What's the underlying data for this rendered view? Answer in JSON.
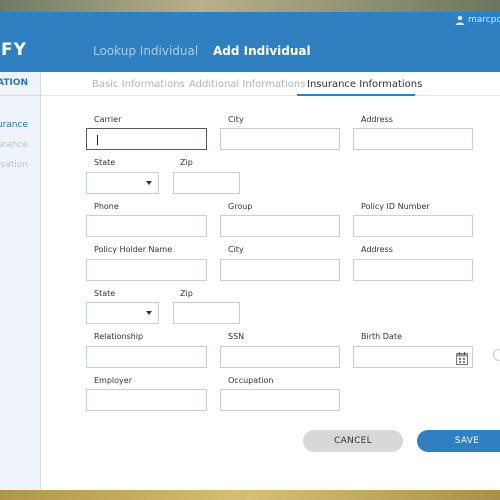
{
  "app": {
    "logo": "FY"
  },
  "header": {
    "nav": [
      {
        "label": "Lookup Individual"
      },
      {
        "label": "Add Individual"
      }
    ],
    "user": {
      "name": "marcpota"
    }
  },
  "sidebar": {
    "title": "MATION",
    "items": [
      {
        "label": "urance"
      },
      {
        "label": "urance"
      },
      {
        "label": "nsation"
      }
    ]
  },
  "tabs": [
    {
      "label": "Basic Informations"
    },
    {
      "label": "Additional Informations"
    },
    {
      "label": "Insurance Informations"
    }
  ],
  "form": {
    "carrier": {
      "label": "Carrier",
      "value": ""
    },
    "city1": {
      "label": "City",
      "value": ""
    },
    "address1": {
      "label": "Address",
      "value": ""
    },
    "state1": {
      "label": "State",
      "value": ""
    },
    "zip1": {
      "label": "Zip",
      "value": ""
    },
    "phone": {
      "label": "Phone",
      "value": ""
    },
    "group": {
      "label": "Group",
      "value": ""
    },
    "policy_id": {
      "label": "Policy ID Number",
      "value": ""
    },
    "holder_name": {
      "label": "Policy Holder Name",
      "value": ""
    },
    "city2": {
      "label": "City",
      "value": ""
    },
    "address2": {
      "label": "Address",
      "value": ""
    },
    "state2": {
      "label": "State",
      "value": ""
    },
    "zip2": {
      "label": "Zip",
      "value": ""
    },
    "relationship": {
      "label": "Relationship",
      "value": ""
    },
    "ssn": {
      "label": "SSN",
      "value": ""
    },
    "birth_date": {
      "label": "Birth Date",
      "value": ""
    },
    "employer": {
      "label": "Employer",
      "value": ""
    },
    "occupation": {
      "label": "Occupation",
      "value": ""
    }
  },
  "actions": {
    "cancel": "CANCEL",
    "save": "SAVE"
  },
  "colors": {
    "accent": "#2f7fc1",
    "cancel_bg": "#d8d8d8"
  }
}
